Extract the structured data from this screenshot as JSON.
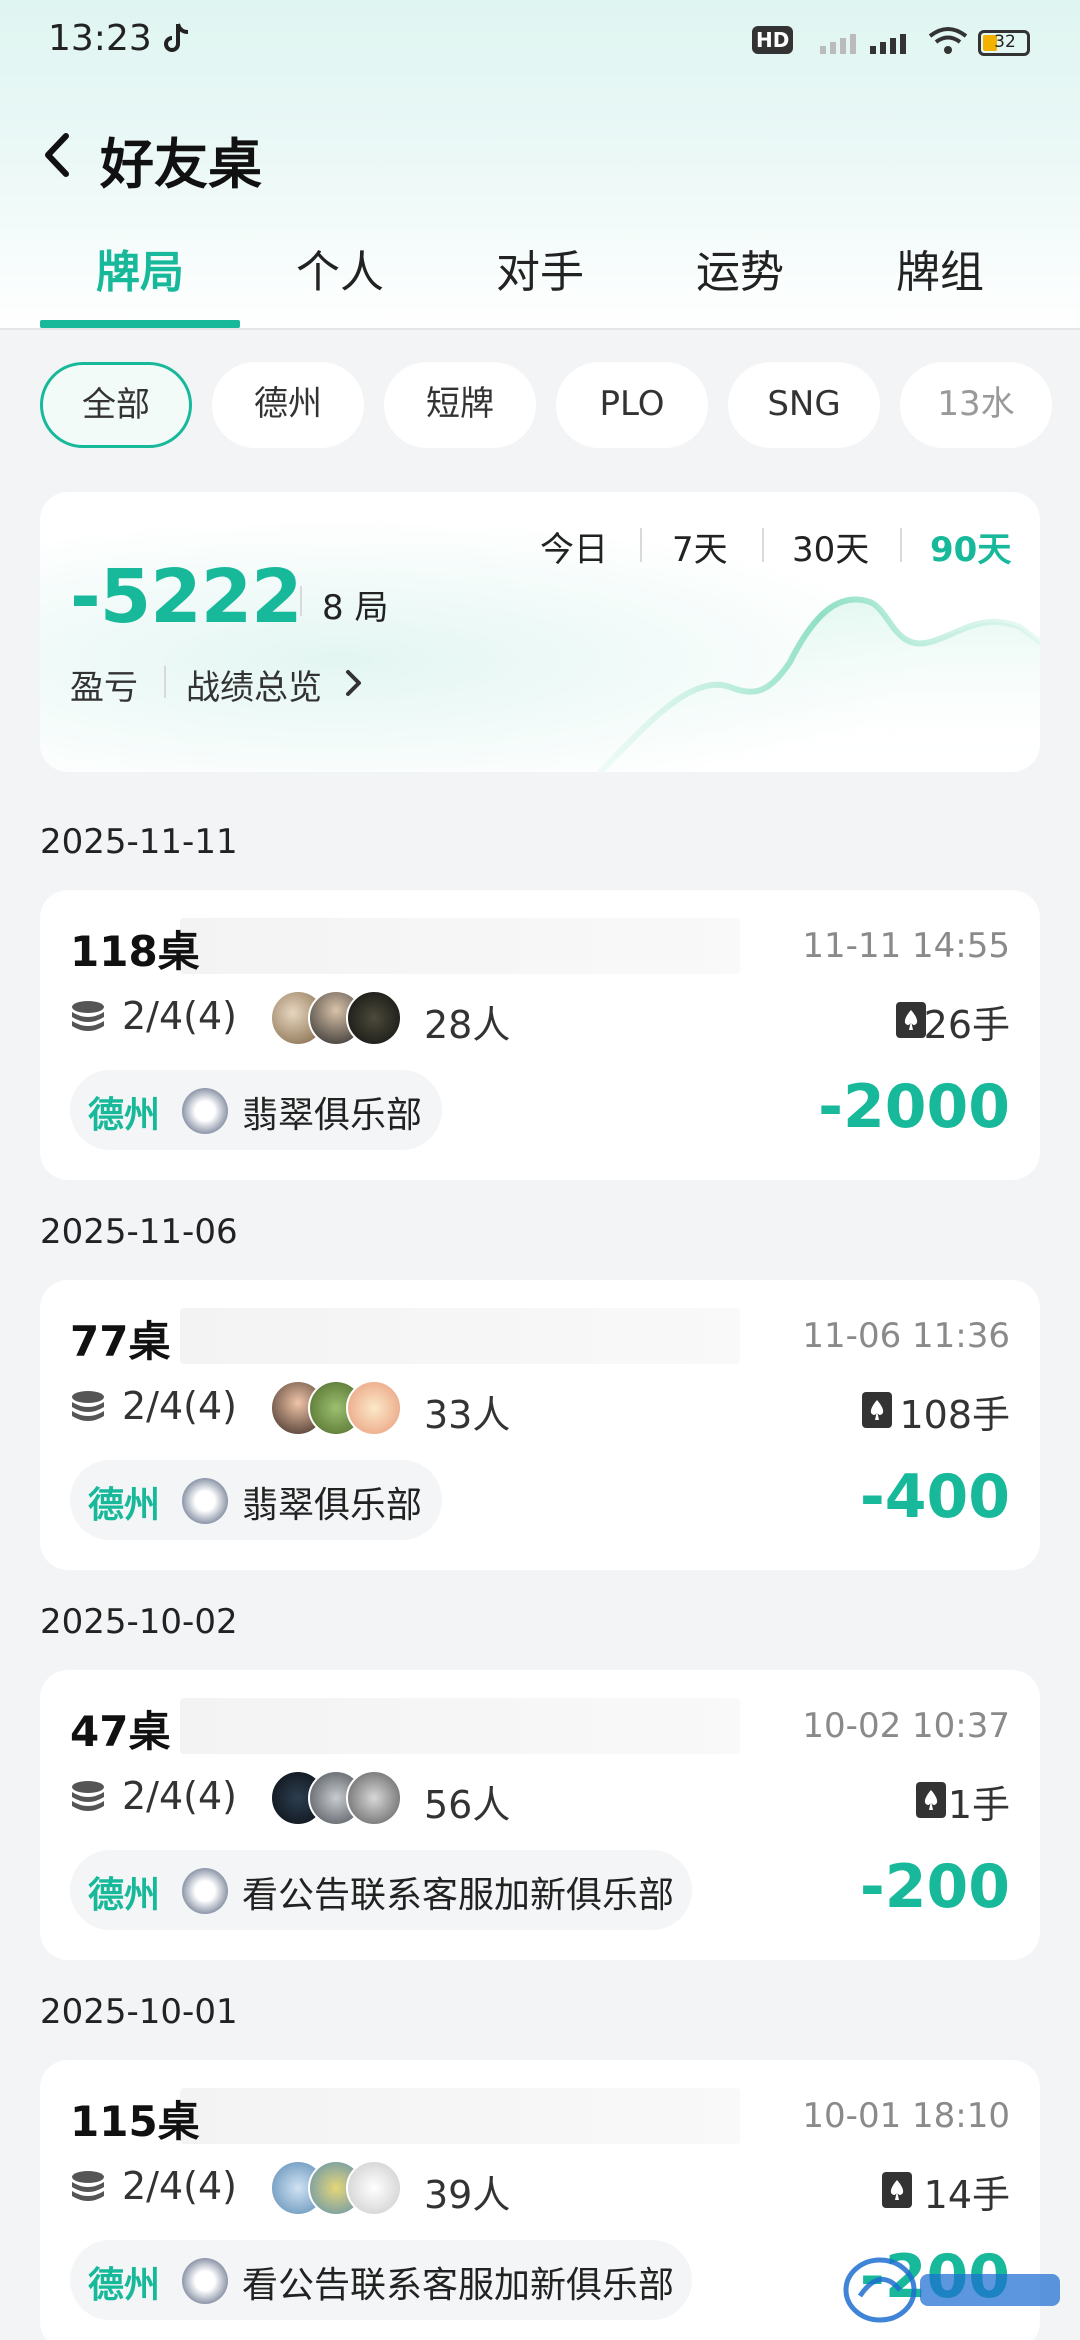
{
  "status_bar": {
    "time": "13:23",
    "battery": "32",
    "network": "4G",
    "hd": "HD"
  },
  "header": {
    "title": "好友桌"
  },
  "tabs": [
    {
      "label": "牌局",
      "active": true
    },
    {
      "label": "个人"
    },
    {
      "label": "对手"
    },
    {
      "label": "运势"
    },
    {
      "label": "牌组"
    }
  ],
  "filters": [
    {
      "label": "全部",
      "active": true
    },
    {
      "label": "德州"
    },
    {
      "label": "短牌"
    },
    {
      "label": "PLO"
    },
    {
      "label": "SNG"
    },
    {
      "label": "13水"
    }
  ],
  "summary": {
    "total": "-5222",
    "rounds": "8 局",
    "pl_label": "盈亏",
    "overview_label": "战绩总览",
    "periods": [
      "今日",
      "7天",
      "30天",
      "90天"
    ],
    "active_period": "90天"
  },
  "colors": {
    "accent": "#17b99a"
  },
  "games": [
    {
      "date": "2025-11-11",
      "table": "118桌",
      "time": "11-11 14:55",
      "blinds": "2/4(4)",
      "players": "28人",
      "hands": "26手",
      "game_type": "德州",
      "club": "翡翠俱乐部",
      "result": "-2000"
    },
    {
      "date": "2025-11-06",
      "table": "77桌",
      "time": "11-06 11:36",
      "blinds": "2/4(4)",
      "players": "33人",
      "hands": "108手",
      "game_type": "德州",
      "club": "翡翠俱乐部",
      "result": "-400"
    },
    {
      "date": "2025-10-02",
      "table": "47桌",
      "time": "10-02 10:37",
      "blinds": "2/4(4)",
      "players": "56人",
      "hands": "1手",
      "game_type": "德州",
      "club": "看公告联系客服加新俱乐部",
      "result": "-200"
    },
    {
      "date": "2025-10-01",
      "table": "115桌",
      "time": "10-01 18:10",
      "blinds": "2/4(4)",
      "players": "39人",
      "hands": "14手",
      "game_type": "德州",
      "club": "看公告联系客服加新俱乐部",
      "result": "-200"
    }
  ]
}
